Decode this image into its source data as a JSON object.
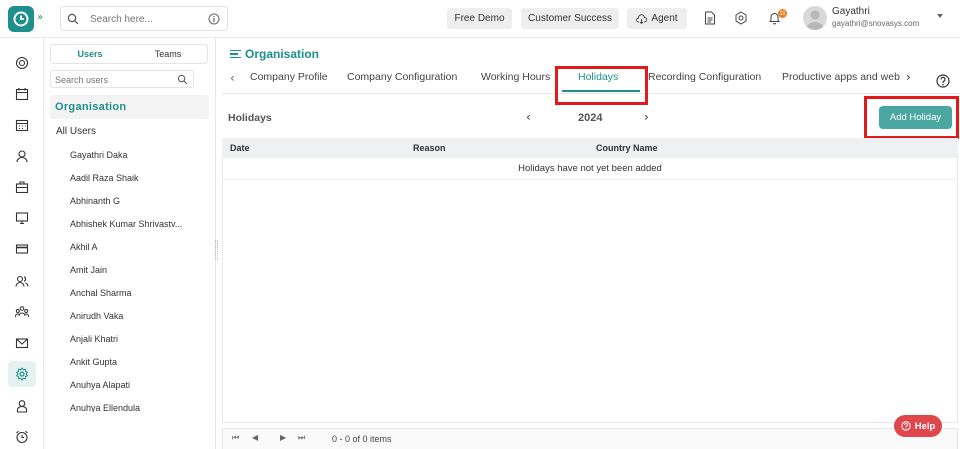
{
  "header": {
    "expand_glyph": "»",
    "search": {
      "placeholder": "Search here..."
    },
    "buttons": {
      "free_demo": "Free Demo",
      "customer_success": "Customer Success",
      "agent": "Agent"
    },
    "notification_count": "11",
    "user": {
      "name": "Gayathri",
      "email": "gayathri@snovasys.com"
    }
  },
  "rail": {
    "icons": [
      "dashboard-icon",
      "calendar-icon",
      "calendar-grid-icon",
      "user-icon",
      "briefcase-icon",
      "monitor-icon",
      "card-icon",
      "users-icon",
      "team-icon",
      "mail-icon",
      "settings-icon",
      "person-badge-icon",
      "alarm-icon"
    ],
    "active_index": 10
  },
  "users_panel": {
    "tabs": {
      "users": "Users",
      "teams": "Teams"
    },
    "search_placeholder": "Search users",
    "org_title": "Organisation",
    "all_users": "All Users",
    "users": [
      "Gayathri Daka",
      "Aadil Raza Shaik",
      "Abhinanth G",
      "Abhishek Kumar Shrivastv...",
      "Akhil A",
      "Amit Jain",
      "Anchal Sharma",
      "Anirudh Vaka",
      "Anjali Khatri",
      "Ankit Gupta",
      "Anuhya Alapati",
      "Anuhya Ellendula"
    ]
  },
  "main": {
    "breadcrumb": "Organisation",
    "tabs": [
      "Company Profile",
      "Company Configuration",
      "Working Hours",
      "Holidays",
      "Recording Configuration",
      "Productive apps and web"
    ],
    "active_tab": "Holidays",
    "section_title": "Holidays",
    "year": "2024",
    "add_button": "Add Holiday",
    "grid": {
      "columns": [
        "Date",
        "Reason",
        "Country Name"
      ],
      "empty_message": "Holidays have not yet been added"
    },
    "pager_info": "0 - 0 of 0 items",
    "help_label": "Help"
  },
  "colors": {
    "accent": "#1e8f8a",
    "button": "#4aa6a0",
    "highlight": "#e11b1b",
    "help": "#e0474c"
  }
}
